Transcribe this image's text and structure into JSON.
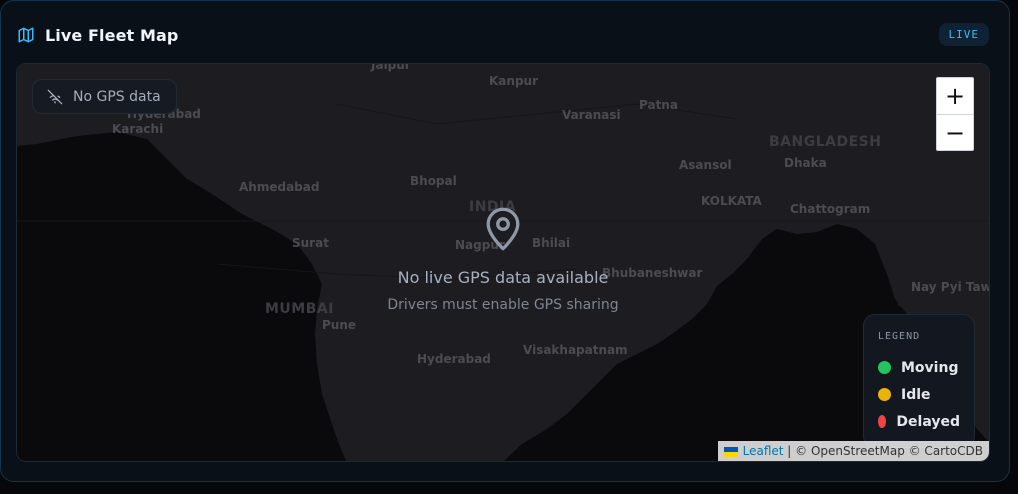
{
  "card": {
    "title": "Live Fleet Map",
    "badge": "LIVE",
    "icon": "map-icon"
  },
  "map": {
    "status_chip": "No GPS data",
    "status_icon": "wifi-off-icon",
    "zoom_in": "+",
    "zoom_out": "−",
    "empty_icon": "map-pin-icon",
    "empty_message": "No live GPS data available",
    "empty_sub": "Drivers must enable GPS sharing",
    "places": [
      {
        "name": "Jaipur"
      },
      {
        "name": "Kanpur"
      },
      {
        "name": "Hyderabad"
      },
      {
        "name": "Karachi"
      },
      {
        "name": "Patna"
      },
      {
        "name": "Varanasi"
      },
      {
        "name": "BANGLADESH"
      },
      {
        "name": "Dhaka"
      },
      {
        "name": "Asansol"
      },
      {
        "name": "KOLKATA"
      },
      {
        "name": "Chattogram"
      },
      {
        "name": "Ahmedabad"
      },
      {
        "name": "Bhopal"
      },
      {
        "name": "INDIA"
      },
      {
        "name": "Surat"
      },
      {
        "name": "Nagpur"
      },
      {
        "name": "Bhilai"
      },
      {
        "name": "Bhubaneshwar"
      },
      {
        "name": "MUMBAI"
      },
      {
        "name": "Pune"
      },
      {
        "name": "Hyderabad"
      },
      {
        "name": "Visakhapatnam"
      },
      {
        "name": "Nay Pyi Taw"
      }
    ]
  },
  "legend": {
    "title": "LEGEND",
    "items": [
      {
        "label": "Moving",
        "color": "#22c55e"
      },
      {
        "label": "Idle",
        "color": "#eab308"
      },
      {
        "label": "Delayed",
        "color": "#ef4444"
      }
    ]
  },
  "attribution": {
    "leaflet": "Leaflet",
    "text": "| © OpenStreetMap © CartoCDB"
  },
  "colors": {
    "accent": "#38bdf8",
    "background": "#0a1018"
  }
}
